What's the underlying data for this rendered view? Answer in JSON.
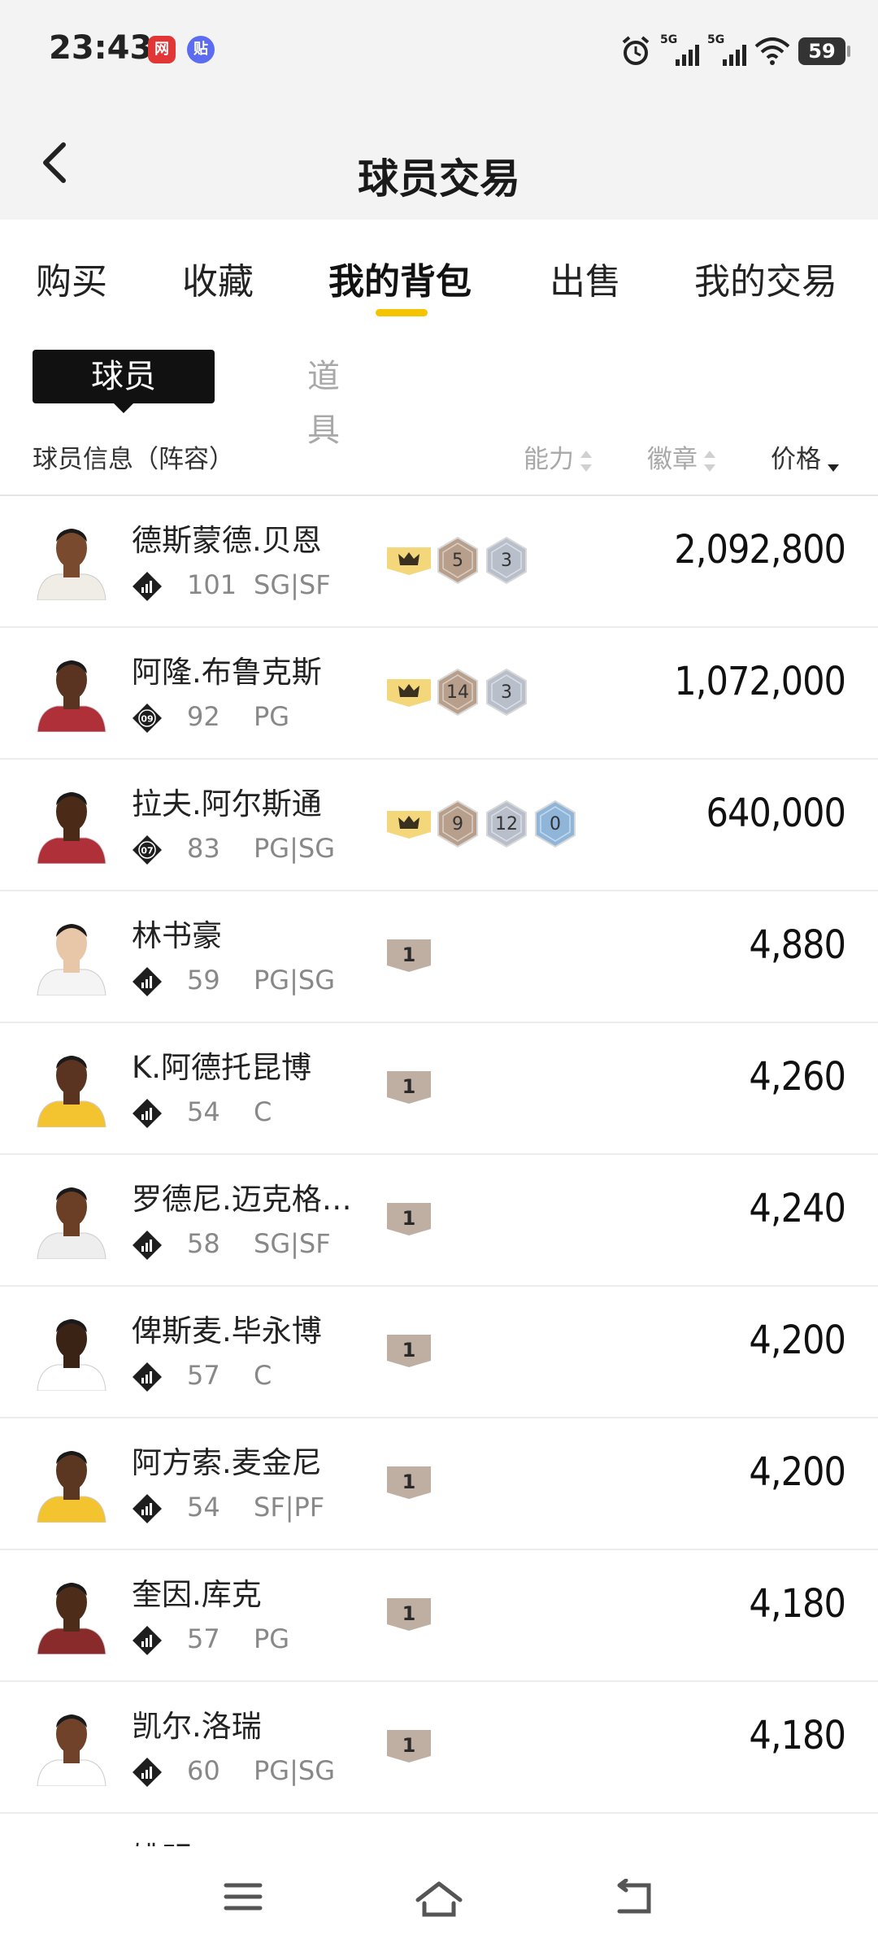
{
  "status_bar": {
    "time": "23:43",
    "notif_1": "网",
    "notif_2": "贴",
    "signal_1": "5G",
    "signal_2": "5G",
    "battery": "59"
  },
  "header": {
    "title": "球员交易",
    "back_icon": "chevron-left-icon"
  },
  "tabs": [
    "购买",
    "收藏",
    "我的背包",
    "出售",
    "我的交易"
  ],
  "active_tab": "我的背包",
  "subtabs": {
    "players": "球员",
    "items": "道具"
  },
  "columns": {
    "info": "球员信息（阵容）",
    "ability": "能力",
    "badges": "徽章",
    "price": "价格"
  },
  "players": [
    {
      "name": "德斯蒙德.贝恩",
      "lineup": "",
      "rating": "101",
      "position": "SG|SF",
      "crown": true,
      "badges": [
        "5",
        "3"
      ],
      "badge_types": [
        "bronze",
        "silver"
      ],
      "price": "2,092,800"
    },
    {
      "name": "阿隆.布鲁克斯",
      "lineup": "09",
      "rating": "92",
      "position": "PG",
      "crown": true,
      "badges": [
        "14",
        "3"
      ],
      "badge_types": [
        "bronze",
        "silver"
      ],
      "price": "1,072,000"
    },
    {
      "name": "拉夫.阿尔斯通",
      "lineup": "07",
      "rating": "83",
      "position": "PG|SG",
      "crown": true,
      "badges": [
        "9",
        "12",
        "0"
      ],
      "badge_types": [
        "bronze",
        "silver",
        "blue"
      ],
      "price": "640,000"
    },
    {
      "name": "林书豪",
      "lineup": "",
      "rating": "59",
      "position": "PG|SG",
      "crown": false,
      "badges": [
        "1"
      ],
      "badge_types": [
        "tier"
      ],
      "price": "4,880"
    },
    {
      "name": "K.阿德托昆博",
      "lineup": "",
      "rating": "54",
      "position": "C",
      "crown": false,
      "badges": [
        "1"
      ],
      "badge_types": [
        "tier"
      ],
      "price": "4,260"
    },
    {
      "name": "罗德尼.迈克格…",
      "lineup": "",
      "rating": "58",
      "position": "SG|SF",
      "crown": false,
      "badges": [
        "1"
      ],
      "badge_types": [
        "tier"
      ],
      "price": "4,240"
    },
    {
      "name": "俾斯麦.毕永博",
      "lineup": "",
      "rating": "57",
      "position": "C",
      "crown": false,
      "badges": [
        "1"
      ],
      "badge_types": [
        "tier"
      ],
      "price": "4,200"
    },
    {
      "name": "阿方索.麦金尼",
      "lineup": "",
      "rating": "54",
      "position": "SF|PF",
      "crown": false,
      "badges": [
        "1"
      ],
      "badge_types": [
        "tier"
      ],
      "price": "4,200"
    },
    {
      "name": "奎因.库克",
      "lineup": "",
      "rating": "57",
      "position": "PG",
      "crown": false,
      "badges": [
        "1"
      ],
      "badge_types": [
        "tier"
      ],
      "price": "4,180"
    },
    {
      "name": "凯尔.洛瑞",
      "lineup": "",
      "rating": "60",
      "position": "PG|SG",
      "crown": false,
      "badges": [
        "1"
      ],
      "badge_types": [
        "tier"
      ],
      "price": "4,180"
    },
    {
      "name": "姚明",
      "lineup": "",
      "rating": "",
      "position": "",
      "crown": true,
      "badges": [
        "",
        ""
      ],
      "badge_types": [
        "bronze",
        "silver"
      ],
      "price": ""
    }
  ],
  "colors": {
    "accent": "#f5c400",
    "crown_bg": "#f3d77a",
    "bronze": "#b79f8c",
    "silver": "#b9bfca",
    "blue": "#8fb6d9",
    "tier": "#bfaea2"
  }
}
